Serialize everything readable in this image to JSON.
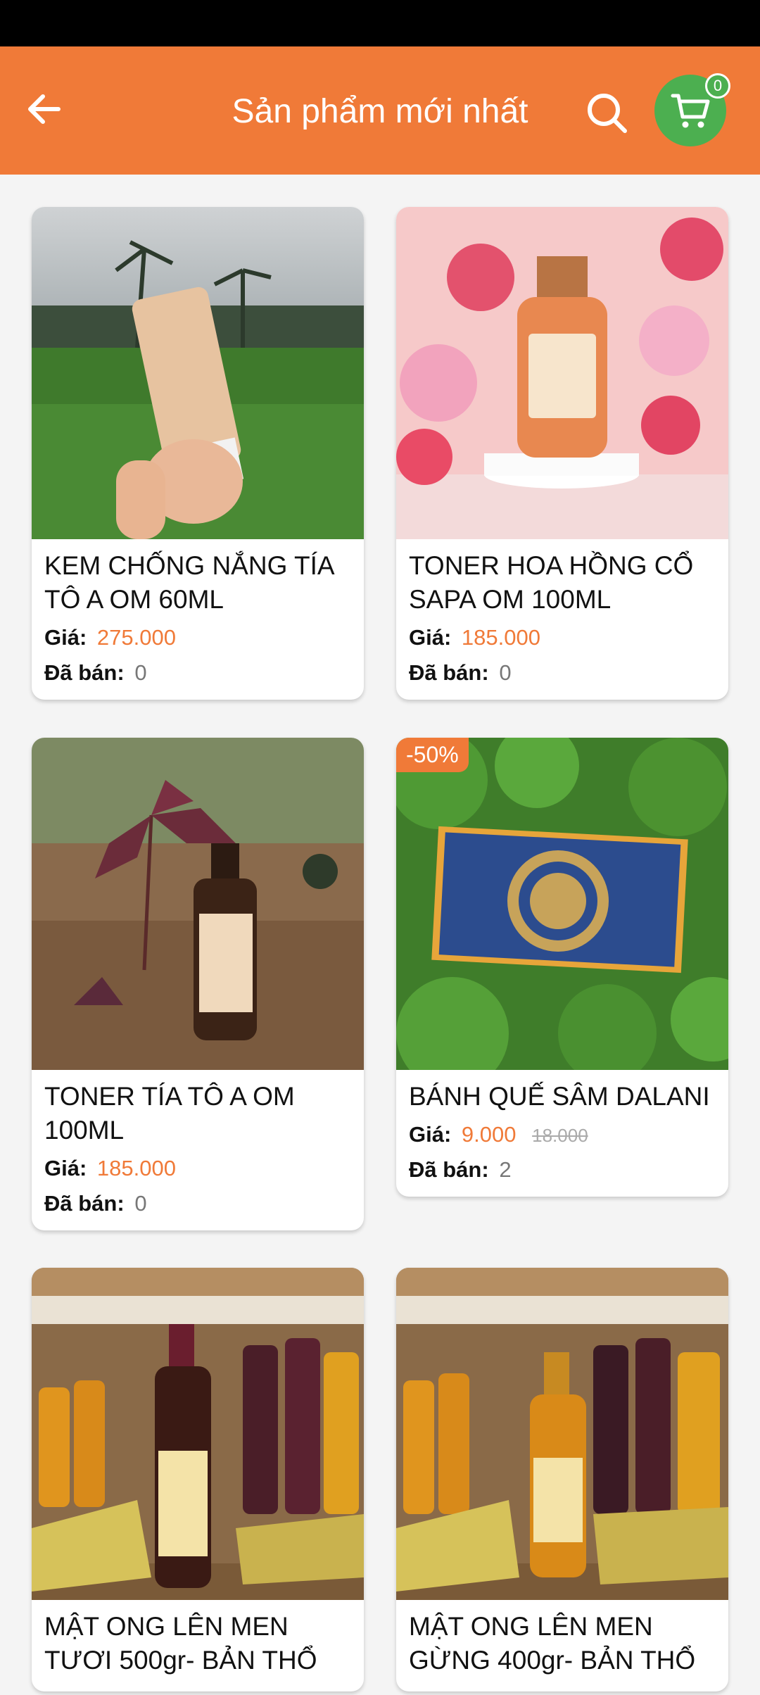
{
  "header": {
    "title": "Sản phẩm mới nhất",
    "cart_count": "0"
  },
  "labels": {
    "price": "Giá:",
    "sold": "Đã bán:"
  },
  "products": [
    {
      "name": "KEM CHỐNG NẮNG TÍA TÔ A OM 60ML",
      "price": "275.000",
      "sold": "0"
    },
    {
      "name": "TONER HOA HỒNG CỔ SAPA OM 100ML",
      "price": "185.000",
      "sold": "0"
    },
    {
      "name": "TONER TÍA TÔ A OM 100ML",
      "price": "185.000",
      "sold": "0"
    },
    {
      "name": "BÁNH QUẾ SÂM DALANI",
      "price": "9.000",
      "old_price": "18.000",
      "sold": "2",
      "discount": "-50%"
    },
    {
      "name": "MẬT ONG LÊN MEN TƯƠI 500gr- BẢN THỔ",
      "price": "",
      "sold": ""
    },
    {
      "name": "MẬT ONG LÊN MEN GỪNG 400gr- BẢN THỔ",
      "price": "",
      "sold": ""
    }
  ],
  "colors": {
    "primary": "#f07a38",
    "cart": "#4caf50"
  }
}
